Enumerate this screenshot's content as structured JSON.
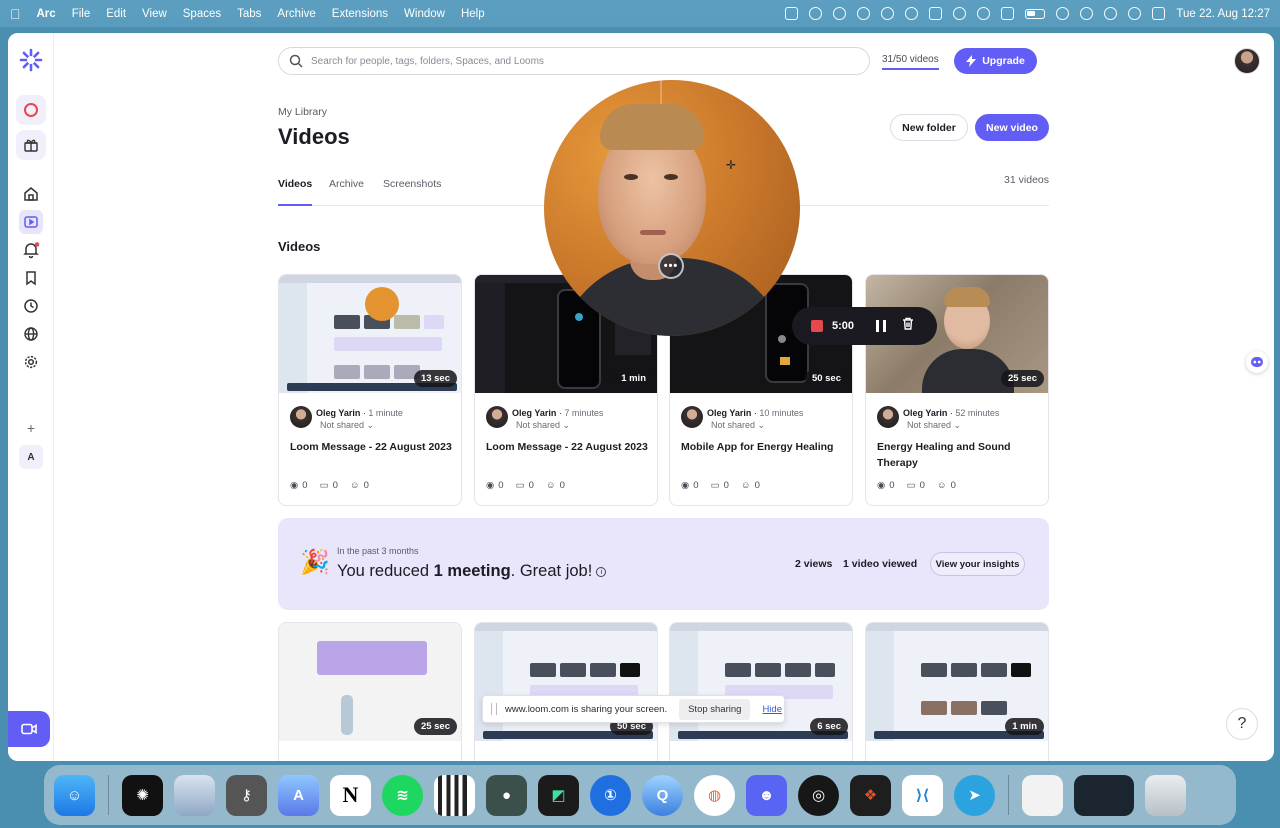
{
  "menubar": {
    "app": "Arc",
    "menus": [
      "File",
      "Edit",
      "View",
      "Spaces",
      "Tabs",
      "Archive",
      "Extensions",
      "Window",
      "Help"
    ],
    "clock": "Tue 22. Aug  12:27"
  },
  "header": {
    "search_placeholder": "Search for people, tags, folders, Spaces, and Looms",
    "video_count": "31/50 videos",
    "upgrade_label": "Upgrade"
  },
  "library": {
    "breadcrumb": "My Library",
    "title": "Videos",
    "new_folder_label": "New folder",
    "new_video_label": "New video",
    "tabs": [
      "Videos",
      "Archive",
      "Screenshots"
    ],
    "total": "31 videos",
    "section_title": "Videos"
  },
  "videos": [
    {
      "duration": "13 sec",
      "author": "Oleg Yarin",
      "time": "1 minute",
      "share": "Not shared",
      "title": "Loom Message - 22 August 2023",
      "views": "0",
      "comments": "0",
      "reactions": "0"
    },
    {
      "duration": "1 min",
      "author": "Oleg Yarin",
      "time": "7 minutes",
      "share": "Not shared",
      "title": "Loom Message - 22 August 2023",
      "views": "0",
      "comments": "0",
      "reactions": "0"
    },
    {
      "duration": "50 sec",
      "author": "Oleg Yarin",
      "time": "10 minutes",
      "share": "Not shared",
      "title": "Mobile App for Energy Healing",
      "views": "0",
      "comments": "0",
      "reactions": "0"
    },
    {
      "duration": "25 sec",
      "author": "Oleg Yarin",
      "time": "52 minutes",
      "share": "Not shared",
      "title": "Energy Healing and Sound Therapy",
      "views": "0",
      "comments": "0",
      "reactions": "0"
    }
  ],
  "insight": {
    "period": "In the past 3 months",
    "message_pre": "You reduced ",
    "message_bold": "1 meeting",
    "message_post": ". Great job!",
    "views": "2 views",
    "viewed": "1 video viewed",
    "button": "View your insights"
  },
  "videos_row2": [
    {
      "duration": "25 sec"
    },
    {
      "duration": "50 sec"
    },
    {
      "duration": "6 sec"
    },
    {
      "duration": "1 min"
    }
  ],
  "recording": {
    "timer": "5:00",
    "more_label": "•••"
  },
  "share_bar": {
    "message": "www.loom.com is sharing your screen.",
    "stop_label": "Stop sharing",
    "hide_label": "Hide"
  },
  "help_label": "?",
  "sidebar": {
    "space_letter": "A",
    "add_label": "+"
  },
  "colors": {
    "accent": "#625df5",
    "insight_bg": "#e9e5fb",
    "record_red": "#e5484d"
  }
}
